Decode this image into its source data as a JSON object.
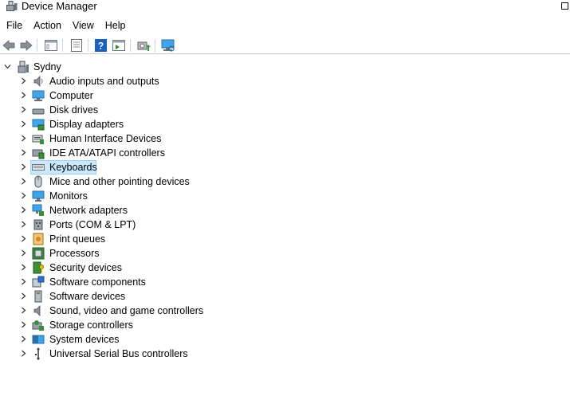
{
  "window": {
    "title": "Device Manager"
  },
  "menu": [
    "File",
    "Action",
    "View",
    "Help"
  ],
  "tree": {
    "root_label": "Sydny",
    "categories": [
      "Audio inputs and outputs",
      "Computer",
      "Disk drives",
      "Display adapters",
      "Human Interface Devices",
      "IDE ATA/ATAPI controllers",
      "Keyboards",
      "Mice and other pointing devices",
      "Monitors",
      "Network adapters",
      "Ports (COM & LPT)",
      "Print queues",
      "Processors",
      "Security devices",
      "Software components",
      "Software devices",
      "Sound, video and game controllers",
      "Storage controllers",
      "System devices",
      "Universal Serial Bus controllers"
    ],
    "selected": "Keyboards"
  },
  "colors": {
    "selection": "#cce8ff",
    "selection_border": "#99d1ff",
    "toolbar_blue": "#1b5fbf"
  }
}
